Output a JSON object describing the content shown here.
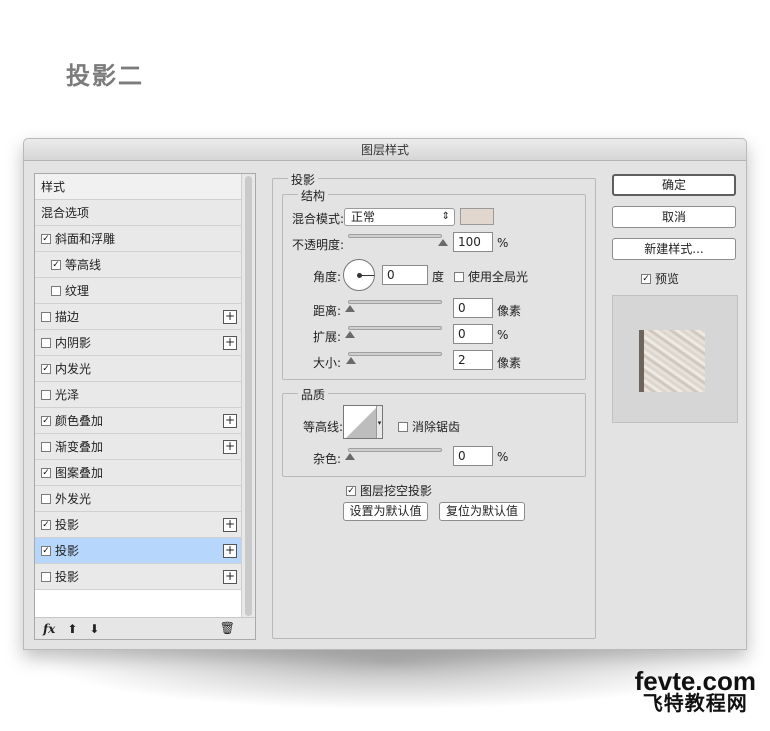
{
  "page": {
    "heading": "投影二"
  },
  "dialog": {
    "title": "图层样式"
  },
  "style_list": {
    "items": [
      {
        "label": "样式",
        "check": false,
        "has_checkbox": false,
        "plus": false,
        "indent": false
      },
      {
        "label": "混合选项",
        "check": false,
        "has_checkbox": false,
        "plus": false,
        "indent": false
      },
      {
        "label": "斜面和浮雕",
        "check": true,
        "has_checkbox": true,
        "plus": false,
        "indent": false
      },
      {
        "label": "等高线",
        "check": true,
        "has_checkbox": true,
        "plus": false,
        "indent": true
      },
      {
        "label": "纹理",
        "check": false,
        "has_checkbox": true,
        "plus": false,
        "indent": true
      },
      {
        "label": "描边",
        "check": false,
        "has_checkbox": true,
        "plus": true,
        "indent": false
      },
      {
        "label": "内阴影",
        "check": false,
        "has_checkbox": true,
        "plus": true,
        "indent": false
      },
      {
        "label": "内发光",
        "check": true,
        "has_checkbox": true,
        "plus": false,
        "indent": false
      },
      {
        "label": "光泽",
        "check": false,
        "has_checkbox": true,
        "plus": false,
        "indent": false
      },
      {
        "label": "颜色叠加",
        "check": true,
        "has_checkbox": true,
        "plus": true,
        "indent": false
      },
      {
        "label": "渐变叠加",
        "check": false,
        "has_checkbox": true,
        "plus": true,
        "indent": false
      },
      {
        "label": "图案叠加",
        "check": true,
        "has_checkbox": true,
        "plus": false,
        "indent": false
      },
      {
        "label": "外发光",
        "check": false,
        "has_checkbox": true,
        "plus": false,
        "indent": false
      },
      {
        "label": "投影",
        "check": true,
        "has_checkbox": true,
        "plus": true,
        "indent": false
      },
      {
        "label": "投影",
        "check": true,
        "has_checkbox": true,
        "plus": true,
        "indent": false,
        "selected": true
      },
      {
        "label": "投影",
        "check": false,
        "has_checkbox": true,
        "plus": true,
        "indent": false
      }
    ],
    "footer": {
      "fx": "fx",
      "up": "⬆",
      "down": "⬇",
      "trash": "🗑"
    }
  },
  "shadow_panel": {
    "group_title": "投影",
    "structure": {
      "title": "结构",
      "blend_mode_label": "混合模式:",
      "blend_mode_value": "正常",
      "blend_color": "#e1d7cf",
      "opacity_label": "不透明度:",
      "opacity_value": "100",
      "opacity_unit": "%",
      "opacity_level": 1.0,
      "angle_label": "角度:",
      "angle_value": "0",
      "angle_unit": "度",
      "global_light_label": "使用全局光",
      "global_light_checked": false,
      "distance_label": "距离:",
      "distance_value": "0",
      "distance_unit": "像素",
      "spread_label": "扩展:",
      "spread_value": "0",
      "spread_unit": "%",
      "size_label": "大小:",
      "size_value": "2",
      "size_unit": "像素"
    },
    "quality": {
      "title": "品质",
      "contour_label": "等高线:",
      "antialias_label": "消除锯齿",
      "antialias_checked": false,
      "noise_label": "杂色:",
      "noise_value": "0",
      "noise_unit": "%"
    },
    "knockout_label": "图层挖空投影",
    "knockout_checked": true,
    "set_default": "设置为默认值",
    "reset_default": "复位为默认值"
  },
  "right": {
    "ok": "确定",
    "cancel": "取消",
    "new_style": "新建样式...",
    "preview_label": "预览",
    "preview_checked": true
  },
  "watermark": {
    "line1": "fevte.com",
    "line2": "飞特教程网"
  }
}
